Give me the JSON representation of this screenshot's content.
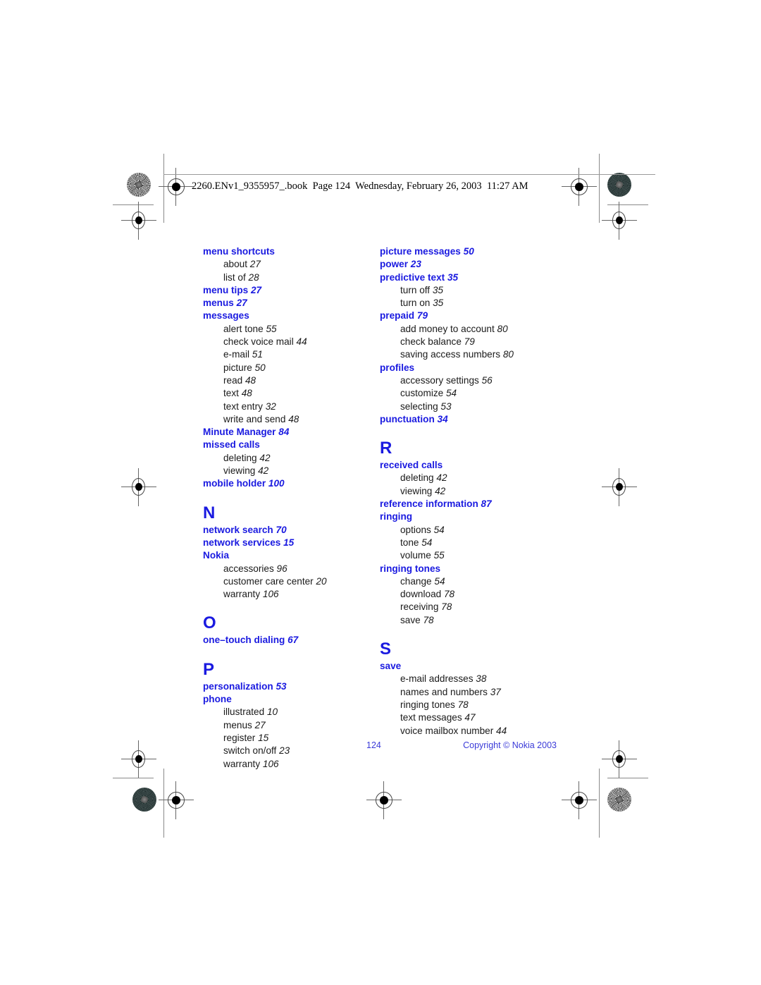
{
  "header": {
    "text": "2260.ENv1_9355957_.book  Page 124  Wednesday, February 26, 2003  11:27 AM"
  },
  "footer": {
    "page_number": "124",
    "copyright": "Copyright © Nokia 2003"
  },
  "colors": {
    "heading_blue": "#1a1ae0",
    "body_text": "#1a1a1a",
    "footer_blue": "#3a3ad8"
  },
  "columns": [
    {
      "id": "left",
      "blocks": [
        {
          "type": "entry",
          "label": "menu shortcuts",
          "page": "",
          "subentries": [
            {
              "label": "about",
              "page": "27"
            },
            {
              "label": "list of",
              "page": "28"
            }
          ]
        },
        {
          "type": "entry",
          "label": "menu tips",
          "page": "27",
          "subentries": []
        },
        {
          "type": "entry",
          "label": "menus",
          "page": "27",
          "subentries": []
        },
        {
          "type": "entry",
          "label": "messages",
          "page": "",
          "subentries": [
            {
              "label": "alert tone",
              "page": "55"
            },
            {
              "label": "check voice mail",
              "page": "44"
            },
            {
              "label": "e-mail",
              "page": "51"
            },
            {
              "label": "picture",
              "page": "50"
            },
            {
              "label": "read",
              "page": "48"
            },
            {
              "label": "text",
              "page": "48"
            },
            {
              "label": "text entry",
              "page": "32"
            },
            {
              "label": "write and send",
              "page": "48"
            }
          ]
        },
        {
          "type": "entry",
          "label": "Minute Manager",
          "page": "84",
          "subentries": []
        },
        {
          "type": "entry",
          "label": "missed calls",
          "page": "",
          "subentries": [
            {
              "label": "deleting",
              "page": "42"
            },
            {
              "label": "viewing",
              "page": "42"
            }
          ]
        },
        {
          "type": "entry",
          "label": "mobile holder",
          "page": "100",
          "subentries": []
        },
        {
          "type": "letter",
          "letter": "N"
        },
        {
          "type": "entry",
          "label": "network search",
          "page": "70",
          "subentries": []
        },
        {
          "type": "entry",
          "label": "network services",
          "page": "15",
          "subentries": []
        },
        {
          "type": "entry",
          "label": "Nokia",
          "page": "",
          "subentries": [
            {
              "label": "accessories",
              "page": "96"
            },
            {
              "label": "customer care center",
              "page": "20"
            },
            {
              "label": "warranty",
              "page": "106"
            }
          ]
        },
        {
          "type": "letter",
          "letter": "O"
        },
        {
          "type": "entry",
          "label": "one–touch dialing",
          "page": "67",
          "subentries": []
        },
        {
          "type": "letter",
          "letter": "P"
        },
        {
          "type": "entry",
          "label": "personalization",
          "page": "53",
          "subentries": []
        },
        {
          "type": "entry",
          "label": "phone",
          "page": "",
          "subentries": [
            {
              "label": "illustrated",
              "page": "10"
            },
            {
              "label": "menus",
              "page": "27"
            },
            {
              "label": "register",
              "page": "15"
            },
            {
              "label": "switch on/off",
              "page": "23"
            },
            {
              "label": "warranty",
              "page": "106"
            }
          ]
        }
      ]
    },
    {
      "id": "right",
      "blocks": [
        {
          "type": "entry",
          "label": "picture messages",
          "page": "50",
          "subentries": []
        },
        {
          "type": "entry",
          "label": "power",
          "page": "23",
          "subentries": []
        },
        {
          "type": "entry",
          "label": "predictive text",
          "page": "35",
          "subentries": [
            {
              "label": "turn off",
              "page": "35"
            },
            {
              "label": "turn on",
              "page": "35"
            }
          ]
        },
        {
          "type": "entry",
          "label": "prepaid",
          "page": "79",
          "subentries": [
            {
              "label": "add money to account",
              "page": "80"
            },
            {
              "label": "check balance",
              "page": "79"
            },
            {
              "label": "saving access numbers",
              "page": "80"
            }
          ]
        },
        {
          "type": "entry",
          "label": "profiles",
          "page": "",
          "subentries": [
            {
              "label": "accessory settings",
              "page": "56"
            },
            {
              "label": "customize",
              "page": "54"
            },
            {
              "label": "selecting",
              "page": "53"
            }
          ]
        },
        {
          "type": "entry",
          "label": "punctuation",
          "page": "34",
          "subentries": []
        },
        {
          "type": "letter",
          "letter": "R"
        },
        {
          "type": "entry",
          "label": "received calls",
          "page": "",
          "subentries": [
            {
              "label": "deleting",
              "page": "42"
            },
            {
              "label": "viewing",
              "page": "42"
            }
          ]
        },
        {
          "type": "entry",
          "label": "reference information",
          "page": "87",
          "subentries": []
        },
        {
          "type": "entry",
          "label": "ringing",
          "page": "",
          "subentries": [
            {
              "label": "options",
              "page": "54"
            },
            {
              "label": "tone",
              "page": "54"
            },
            {
              "label": "volume",
              "page": "55"
            }
          ]
        },
        {
          "type": "entry",
          "label": "ringing tones",
          "page": "",
          "subentries": [
            {
              "label": "change",
              "page": "54"
            },
            {
              "label": "download",
              "page": "78"
            },
            {
              "label": "receiving",
              "page": "78"
            },
            {
              "label": "save",
              "page": "78"
            }
          ]
        },
        {
          "type": "letter",
          "letter": "S"
        },
        {
          "type": "entry",
          "label": "save",
          "page": "",
          "subentries": [
            {
              "label": "e-mail addresses",
              "page": "38"
            },
            {
              "label": "names and numbers",
              "page": "37"
            },
            {
              "label": "ringing tones",
              "page": "78"
            },
            {
              "label": "text messages",
              "page": "47"
            },
            {
              "label": "voice mailbox number",
              "page": "44"
            }
          ]
        }
      ]
    }
  ],
  "print_marks": {
    "description": "registration crosshairs, starburst color patches and crop lines"
  }
}
